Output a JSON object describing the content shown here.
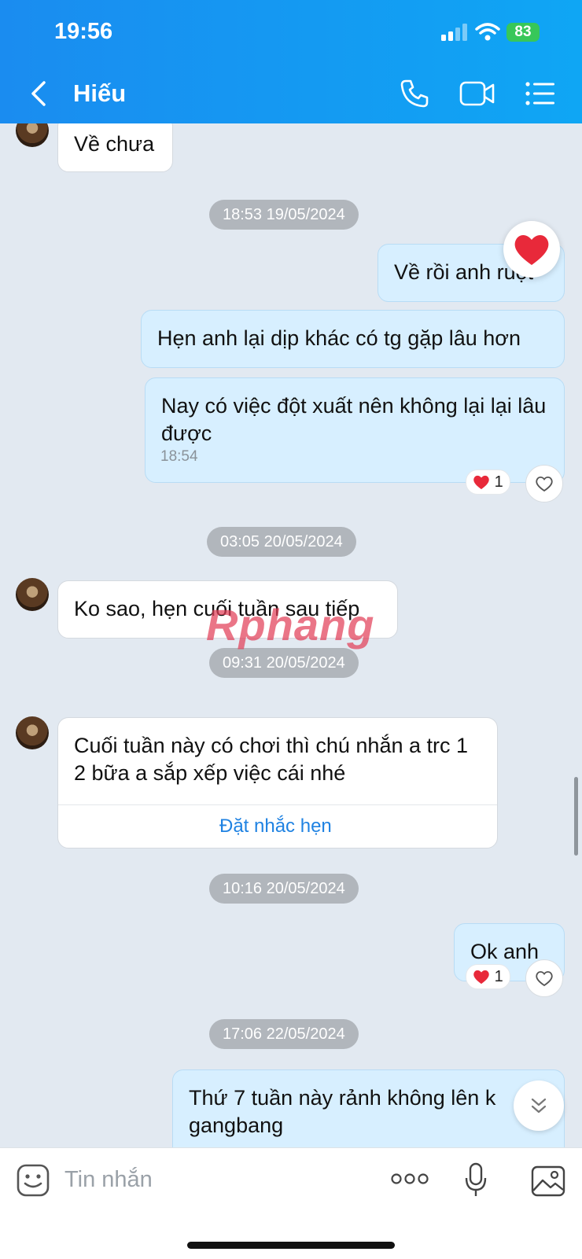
{
  "status_bar": {
    "time": "19:56",
    "battery": "83"
  },
  "header": {
    "contact_name": "Hiếu"
  },
  "messages": {
    "m1": "Về chưa",
    "ts1": "18:53 19/05/2024",
    "m2": "Về rồi anh ruột",
    "m3": "Hẹn anh lại dịp khác có tg gặp lâu hơn",
    "m4": "Nay có việc đột xuất nên không lại lại lâu được",
    "m4_time": "18:54",
    "react1": "1",
    "ts2": "03:05 20/05/2024",
    "m5": "Ko sao, hẹn cuối tuần sau tiếp",
    "ts3": "09:31 20/05/2024",
    "m6": "Cuối tuần này có chơi thì chú nhắn a trc 1 2 bữa a sắp xếp việc cái nhé",
    "m6_action": "Đặt nhắc hẹn",
    "ts4": "10:16 20/05/2024",
    "m7": "Ok anh",
    "react2": "1",
    "ts5": "17:06 22/05/2024",
    "m8": "Thứ 7 tuần này rảnh không lên k gangbang"
  },
  "watermark": "Rphang",
  "input": {
    "placeholder": "Tin nhắn"
  },
  "colors": {
    "header_start": "#1a8cf0",
    "header_end": "#0fa6f4",
    "chat_bg": "#e2e9f1",
    "outgoing_bubble": "#d7efff",
    "link": "#1f82e2",
    "heart": "#e8293a"
  }
}
